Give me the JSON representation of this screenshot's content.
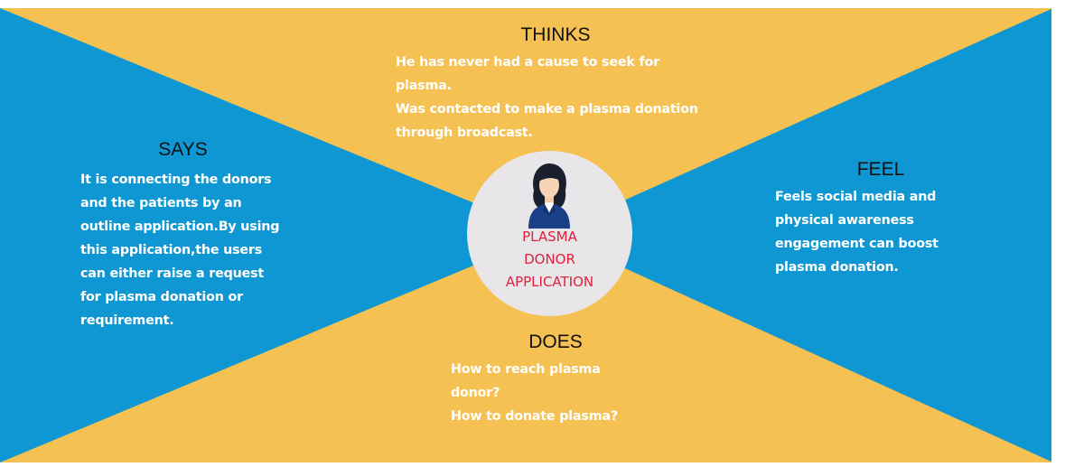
{
  "colors": {
    "blue": "#0e97d3",
    "yellow": "#f4c152",
    "circle": "#e8e6e9",
    "label_red": "#e0203c",
    "text_white": "#ffffff",
    "title_black": "#111111"
  },
  "thinks": {
    "title": "THINKS",
    "lines": [
      "He has never had a cause to seek for",
      "plasma.",
      "Was contacted to make a plasma donation",
      "through broadcast."
    ]
  },
  "says": {
    "title": "SAYS",
    "lines": [
      "It is connecting the donors",
      "and the patients by an",
      "outline application.By using",
      "this application,the users",
      "can either raise a request",
      "for plasma donation or",
      "requirement."
    ]
  },
  "feel": {
    "title": "FEEL",
    "lines": [
      "Feels social media and",
      "physical awareness",
      "engagement can boost",
      "plasma donation."
    ]
  },
  "does": {
    "title": "DOES",
    "lines": [
      "How to reach plasma",
      "donor?",
      "How to donate plasma?"
    ]
  },
  "center": {
    "icon": "woman-avatar-icon",
    "label_lines": [
      "PLASMA",
      "DONOR",
      "APPLICATION"
    ]
  }
}
